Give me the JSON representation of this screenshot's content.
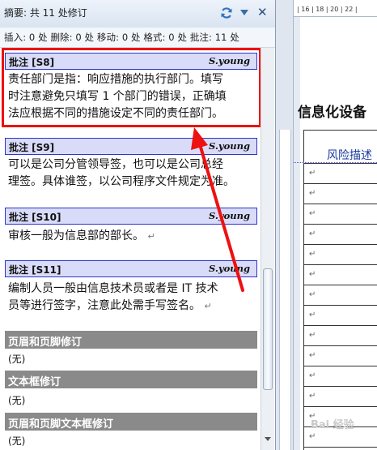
{
  "pane": {
    "title": "摘要: 共 11 处修订",
    "counts": "插入: 0 处  删除: 0 处  移动: 0 处  格式: 0 处  批注: 11 处"
  },
  "comments": [
    {
      "label": "批注 [S8]",
      "author": "S.young",
      "lines": [
        "责任部门是指：响应措施的执行部门。填写",
        "时注意避免只填写 1 个部门的错误，正确填",
        "法应根据不同的措施设定不同的责任部门。"
      ]
    },
    {
      "label": "批注 [S9]",
      "author": "S.young",
      "lines": [
        "可以是公司分管领导签，也可以是公司总经",
        "理签。具体谁签，以公司程序文件规定为准。"
      ]
    },
    {
      "label": "批注 [S10]",
      "author": "S.young",
      "lines": [
        "审核一般为信息部的部长。"
      ]
    },
    {
      "label": "批注 [S11]",
      "author": "S.young",
      "lines": [
        "编制人员一般由信息技术员或者是 IT 技术",
        "员等进行签字，注意此处需手写签名。"
      ]
    }
  ],
  "sections": [
    {
      "label": "页眉和页脚修订",
      "value": "(无)"
    },
    {
      "label": "文本框修订",
      "value": "(无)"
    },
    {
      "label": "页眉和页脚文本框修订",
      "value": "(无)"
    }
  ],
  "document": {
    "title": "信息化设备",
    "risk_header": "风险描述",
    "ruler": "| 16 | 18 | 20 | 22 |"
  },
  "watermark": "Bai 经验",
  "colors": {
    "highlight": "#ee1111",
    "comment_border": "#2d33cc",
    "comment_fill": "#d9dcf8",
    "section_fill": "#8a8a8a"
  },
  "icons": {
    "refresh": "refresh-icon",
    "collapse": "chevron-down-icon",
    "close": "close-icon"
  }
}
